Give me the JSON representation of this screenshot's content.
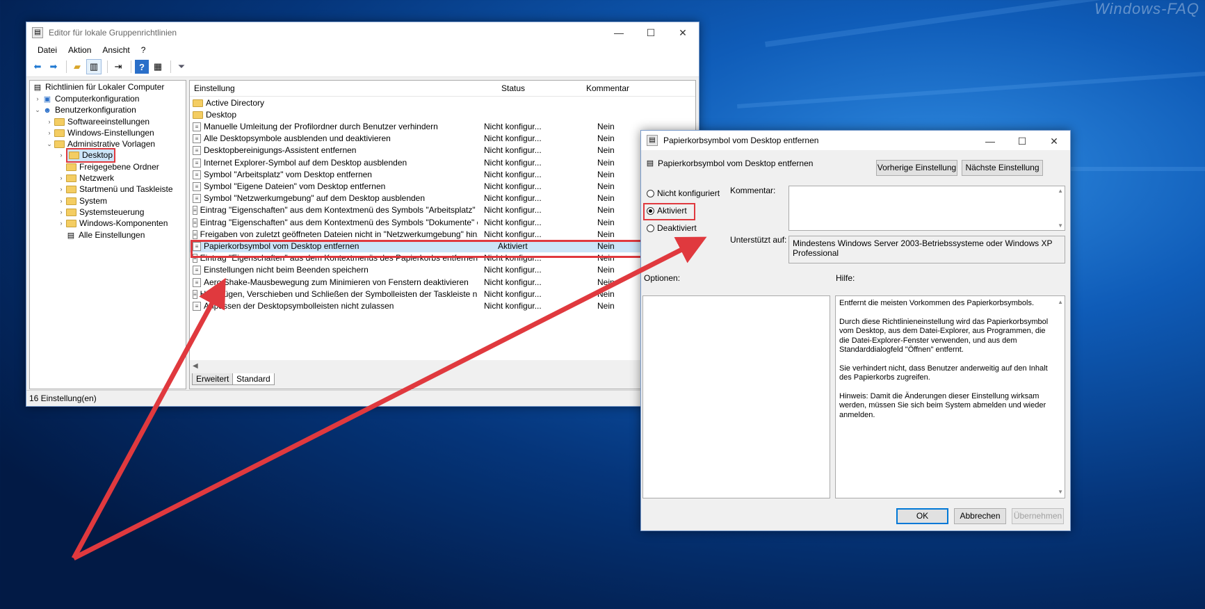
{
  "watermark": "Windows-FAQ",
  "main_window": {
    "title": "Editor für lokale Gruppenrichtlinien",
    "menu": [
      "Datei",
      "Aktion",
      "Ansicht",
      "?"
    ],
    "tree": {
      "root": "Richtlinien für Lokaler Computer",
      "computer_config": "Computerkonfiguration",
      "user_config": "Benutzerkonfiguration",
      "software_settings": "Softwareeinstellungen",
      "windows_settings": "Windows-Einstellungen",
      "admin_templates": "Administrative Vorlagen",
      "desktop": "Desktop",
      "shared_folders": "Freigegebene Ordner",
      "network": "Netzwerk",
      "start_menu": "Startmenü und Taskleiste",
      "system": "System",
      "control_panel": "Systemsteuerung",
      "windows_components": "Windows-Komponenten",
      "all_settings": "Alle Einstellungen"
    },
    "columns": {
      "setting": "Einstellung",
      "status": "Status",
      "comment": "Kommentar"
    },
    "folders": [
      "Active Directory",
      "Desktop"
    ],
    "rows": [
      {
        "name": "Manuelle Umleitung der Profilordner durch Benutzer verhindern",
        "status": "Nicht konfigur...",
        "comment": "Nein"
      },
      {
        "name": "Alle Desktopsymbole ausblenden und deaktivieren",
        "status": "Nicht konfigur...",
        "comment": "Nein"
      },
      {
        "name": "Desktopbereinigungs-Assistent entfernen",
        "status": "Nicht konfigur...",
        "comment": "Nein"
      },
      {
        "name": "Internet Explorer-Symbol auf dem Desktop ausblenden",
        "status": "Nicht konfigur...",
        "comment": "Nein"
      },
      {
        "name": "Symbol \"Arbeitsplatz\" vom Desktop entfernen",
        "status": "Nicht konfigur...",
        "comment": "Nein"
      },
      {
        "name": "Symbol \"Eigene Dateien\" vom Desktop entfernen",
        "status": "Nicht konfigur...",
        "comment": "Nein"
      },
      {
        "name": "Symbol \"Netzwerkumgebung\" auf dem Desktop ausblenden",
        "status": "Nicht konfigur...",
        "comment": "Nein"
      },
      {
        "name": "Eintrag \"Eigenschaften\" aus dem Kontextmenü des Symbols \"Arbeitsplatz\" entfer...",
        "status": "Nicht konfigur...",
        "comment": "Nein"
      },
      {
        "name": "Eintrag \"Eigenschaften\" aus dem Kontextmenü des Symbols \"Dokumente\" entfer...",
        "status": "Nicht konfigur...",
        "comment": "Nein"
      },
      {
        "name": "Freigaben von zuletzt geöffneten Dateien nicht in \"Netzwerkumgebung\" hinzufü...",
        "status": "Nicht konfigur...",
        "comment": "Nein"
      },
      {
        "name": "Papierkorbsymbol vom Desktop entfernen",
        "status": "Aktiviert",
        "comment": "Nein"
      },
      {
        "name": "Eintrag \"Eigenschaften\" aus dem Kontextmenüs des Papierkorbs entfernen",
        "status": "Nicht konfigur...",
        "comment": "Nein"
      },
      {
        "name": "Einstellungen nicht beim Beenden speichern",
        "status": "Nicht konfigur...",
        "comment": "Nein"
      },
      {
        "name": "Aero Shake-Mausbewegung zum Minimieren von Fenstern deaktivieren",
        "status": "Nicht konfigur...",
        "comment": "Nein"
      },
      {
        "name": "Hinzufügen, Verschieben und Schließen der Symbolleisten der Taskleiste nicht zul...",
        "status": "Nicht konfigur...",
        "comment": "Nein"
      },
      {
        "name": "Anpassen der Desktopsymbolleisten nicht zulassen",
        "status": "Nicht konfigur...",
        "comment": "Nein"
      }
    ],
    "tabs": {
      "extended": "Erweitert",
      "standard": "Standard"
    },
    "status_bar": "16 Einstellung(en)"
  },
  "dialog": {
    "title": "Papierkorbsymbol vom Desktop entfernen",
    "subtitle": "Papierkorbsymbol vom Desktop entfernen",
    "prev_button": "Vorherige Einstellung",
    "next_button": "Nächste Einstellung",
    "radio_not_configured": "Nicht konfiguriert",
    "radio_enabled": "Aktiviert",
    "radio_disabled": "Deaktiviert",
    "selected_option": "Aktiviert",
    "comment_label": "Kommentar:",
    "supported_label": "Unterstützt auf:",
    "supported_value": "Mindestens Windows Server 2003-Betriebssysteme oder Windows XP Professional",
    "options_label": "Optionen:",
    "help_label": "Hilfe:",
    "help_paragraphs": [
      "Entfernt die meisten Vorkommen des Papierkorbsymbols.",
      "Durch diese Richtlinieneinstellung wird das Papierkorbsymbol vom Desktop, aus dem Datei-Explorer, aus Programmen, die die Datei-Explorer-Fenster verwenden, und aus dem Standarddialogfeld \"Öffnen\" entfernt.",
      "Sie verhindert nicht, dass Benutzer anderweitig auf den Inhalt des Papierkorbs zugreifen.",
      "Hinweis: Damit die Änderungen dieser Einstellung wirksam werden, müssen Sie sich beim System abmelden und wieder anmelden."
    ],
    "ok_button": "OK",
    "cancel_button": "Abbrechen",
    "apply_button": "Übernehmen"
  },
  "colors": {
    "annotation_red": "#e0393e",
    "selection_blue": "#cce4f7",
    "desktop_blue": "#0f5cb8"
  }
}
